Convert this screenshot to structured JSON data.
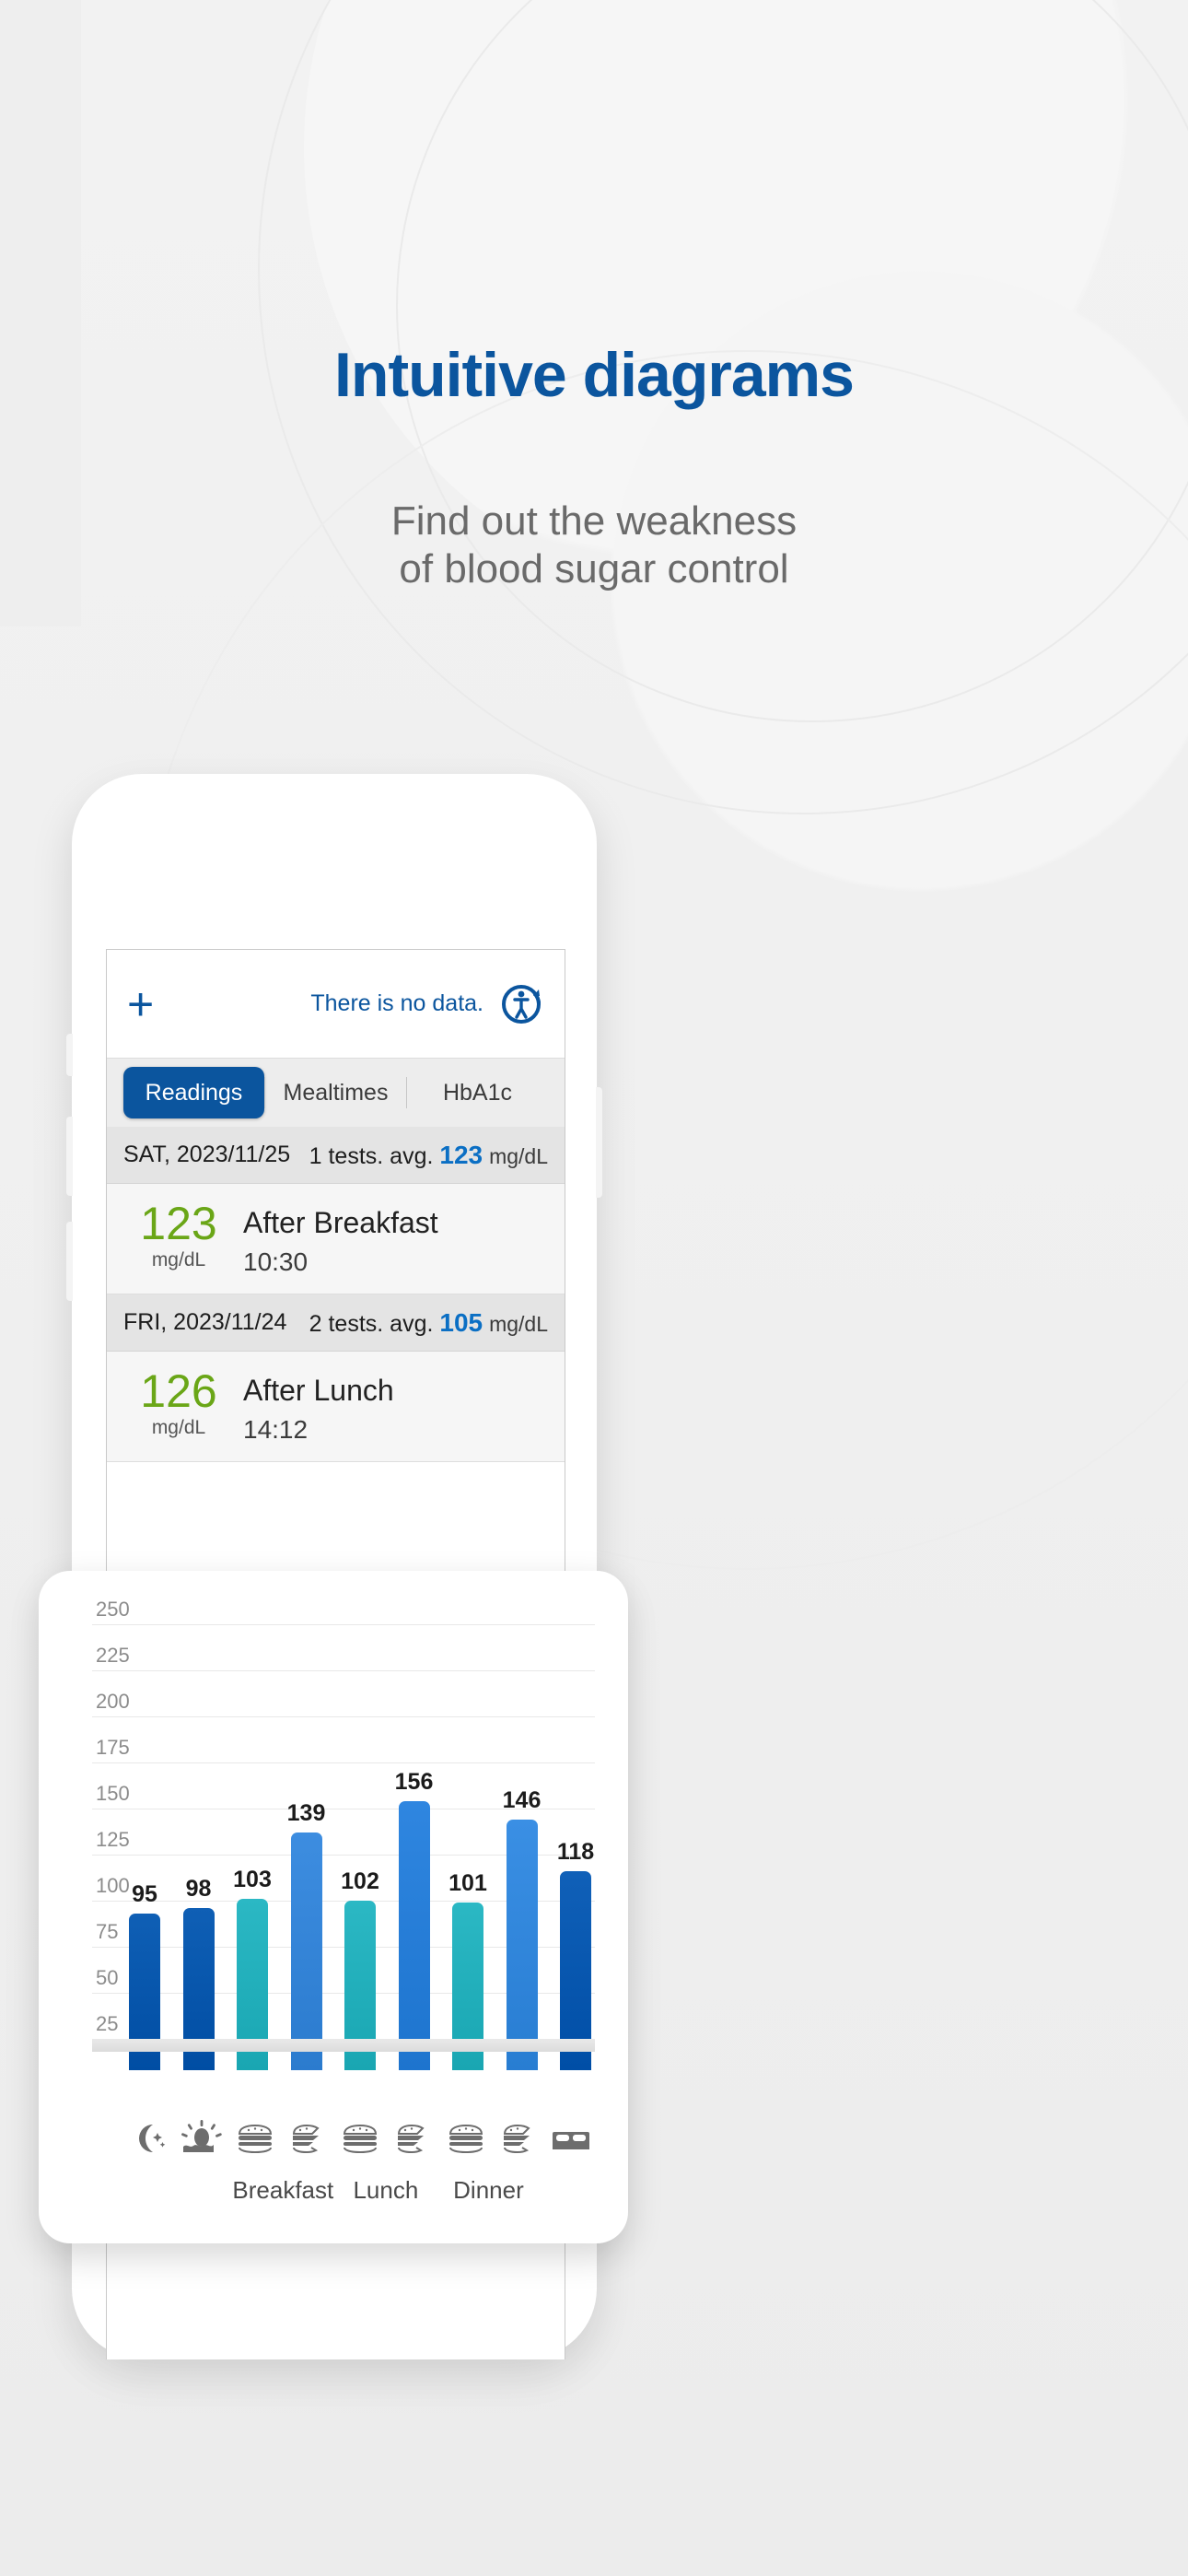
{
  "promo": {
    "headline": "Intuitive diagrams",
    "subhead_line1": "Find out the weakness",
    "subhead_line2": "of blood sugar control",
    "headline_color": "#0b559e",
    "subhead_color": "#6a6a6a"
  },
  "app": {
    "topbar": {
      "add_label": "+",
      "message": "There is no data.",
      "sync_icon": "sync-person-icon"
    },
    "tabs": [
      {
        "label": "Readings",
        "active": true
      },
      {
        "label": "Mealtimes",
        "active": false
      },
      {
        "label": "HbA1c",
        "active": false
      }
    ],
    "day_groups": [
      {
        "date": "SAT, 2023/11/25",
        "tests": "1 tests. avg.",
        "avg": "123",
        "unit": "mg/dL",
        "readings": [
          {
            "value": "123",
            "unit": "mg/dL",
            "name": "After Breakfast",
            "time": "10:30",
            "color": "#6aa617"
          }
        ]
      },
      {
        "date": "FRI, 2023/11/24",
        "tests": "2 tests. avg.",
        "avg": "105",
        "unit": "mg/dL",
        "readings": [
          {
            "value": "126",
            "unit": "mg/dL",
            "name": "After Lunch",
            "time": "14:12",
            "color": "#6aa617"
          }
        ]
      }
    ]
  },
  "chart_data": {
    "type": "bar",
    "title": "",
    "xlabel": "",
    "ylabel": "",
    "ylim": [
      0,
      262
    ],
    "grid": true,
    "yticks": [
      250,
      225,
      200,
      175,
      150,
      125,
      100,
      75,
      50,
      25
    ],
    "categories": [
      "Night",
      "Morning",
      "Before Breakfast",
      "After Breakfast",
      "Before Lunch",
      "After Lunch",
      "Before Dinner",
      "After Dinner",
      "Bedtime"
    ],
    "values": [
      95,
      98,
      103,
      139,
      102,
      156,
      101,
      146,
      118
    ],
    "bar_colors": [
      "#0f5fb5",
      "#0f5fb5",
      "#2bb8c4",
      "#3d8de0",
      "#2bb8c4",
      "#2f86e0",
      "#2bb8c4",
      "#3a8fe4",
      "#1060b8"
    ],
    "icons": [
      "moon-stars-icon",
      "sunrise-icon",
      "burger-full-icon",
      "burger-eaten-icon",
      "burger-full-icon",
      "burger-eaten-icon",
      "burger-full-icon",
      "burger-eaten-icon",
      "bed-icon"
    ],
    "group_labels": [
      {
        "text": "Breakfast",
        "between": [
          2,
          3
        ]
      },
      {
        "text": "Lunch",
        "between": [
          4,
          5
        ]
      },
      {
        "text": "Dinner",
        "between": [
          6,
          7
        ]
      }
    ]
  }
}
